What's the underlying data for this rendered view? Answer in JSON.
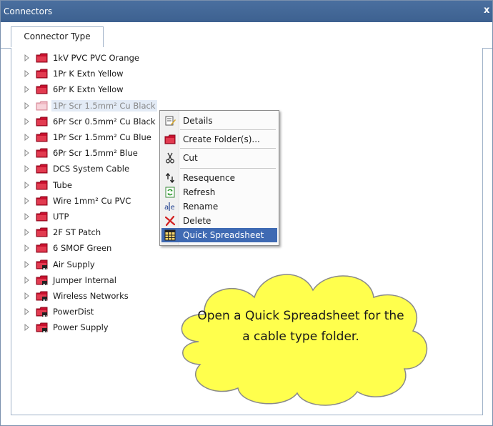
{
  "window": {
    "title": "Connectors",
    "close_glyph": "x"
  },
  "tabs": [
    {
      "label": "Connector Type"
    }
  ],
  "tree": {
    "items": [
      {
        "label": "1kV PVC PVC Orange",
        "icon": "folder-icon"
      },
      {
        "label": "1Pr K Extn Yellow",
        "icon": "folder-icon"
      },
      {
        "label": "6Pr K Extn Yellow",
        "icon": "folder-icon"
      },
      {
        "label": "1Pr Scr 1.5mm² Cu Black",
        "icon": "folder-icon",
        "selected": true
      },
      {
        "label": "6Pr Scr 0.5mm² Cu Black",
        "icon": "folder-icon"
      },
      {
        "label": "1Pr Scr 1.5mm² Cu Blue",
        "icon": "folder-icon"
      },
      {
        "label": "6Pr Scr 1.5mm² Blue",
        "icon": "folder-icon"
      },
      {
        "label": "DCS System Cable",
        "icon": "folder-icon"
      },
      {
        "label": "Tube",
        "icon": "folder-icon"
      },
      {
        "label": "Wire 1mm² Cu  PVC",
        "icon": "folder-icon"
      },
      {
        "label": "UTP",
        "icon": "folder-icon"
      },
      {
        "label": "2F ST Patch",
        "icon": "folder-icon"
      },
      {
        "label": "6 SMOF Green",
        "icon": "folder-icon"
      },
      {
        "label": "Air Supply",
        "icon": "connector-folder-icon"
      },
      {
        "label": "Jumper Internal",
        "icon": "connector-folder-icon"
      },
      {
        "label": "Wireless Networks",
        "icon": "connector-folder-icon"
      },
      {
        "label": "PowerDist",
        "icon": "connector-folder-icon"
      },
      {
        "label": "Power Supply",
        "icon": "connector-folder-icon"
      }
    ]
  },
  "context_menu": {
    "items": [
      {
        "label": "Details",
        "icon": "details-icon"
      },
      {
        "label": "Create Folder(s)...",
        "icon": "folder-icon"
      },
      {
        "label": "Cut",
        "icon": "scissors-icon"
      },
      {
        "label": "Resequence",
        "icon": "resequence-icon"
      },
      {
        "label": "Refresh",
        "icon": "refresh-icon"
      },
      {
        "label": "Rename",
        "icon": "rename-icon"
      },
      {
        "label": "Delete",
        "icon": "delete-icon"
      },
      {
        "label": "Quick Spreadsheet",
        "icon": "spreadsheet-icon",
        "highlighted": true
      }
    ]
  },
  "callout": {
    "text": "Open a Quick Spreadsheet for the a cable type folder."
  },
  "colors": {
    "titlebar": "#4a6f9f",
    "folder": "#c8102e",
    "callout_fill": "#ffff4d",
    "callout_border": "#8a8a8a",
    "menu_highlight": "#3f6ab3"
  }
}
